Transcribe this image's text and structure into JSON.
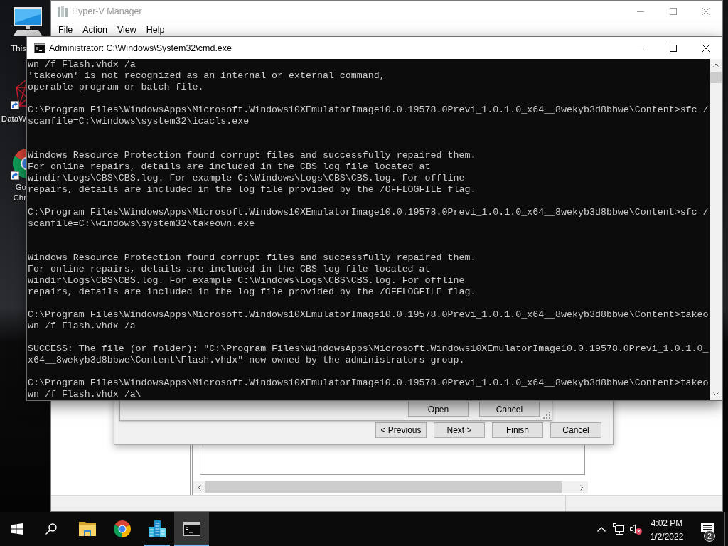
{
  "desktop": {
    "icons": [
      {
        "kind": "computer",
        "label_lines": [
          "This"
        ],
        "shortcut": false
      },
      {
        "kind": "mesh",
        "label_lines": [
          "DataW"
        ],
        "shortcut": true
      },
      {
        "kind": "browser",
        "label_lines": [
          "Go",
          "Chr"
        ],
        "shortcut": true
      }
    ]
  },
  "hyperv_window": {
    "title": "Hyper-V Manager",
    "active": false,
    "menu": [
      "File",
      "Action",
      "View",
      "Help"
    ]
  },
  "wizard_dialog": {
    "buttons": [
      "< Previous",
      "Next >",
      "Finish",
      "Cancel"
    ]
  },
  "open_dialog": {
    "buttons": [
      "Open",
      "Cancel"
    ]
  },
  "console_window": {
    "title": "Administrator: C:\\Windows\\System32\\cmd.exe",
    "active": true,
    "blocks": [
      {
        "kind": "text",
        "lines": [
          "wn /f Flash.vhdx /a",
          "'takeown' is not recognized as an internal or external command,",
          "operable program or batch file."
        ]
      },
      {
        "kind": "text",
        "lines": [
          "C:\\Program Files\\WindowsApps\\Microsoft.Windows10XEmulatorImage10.0.19578.0Previ_1.0.1.0_x64__8wekyb3d8bbwe\\Content>sfc /",
          "scanfile=C:\\windows\\system32\\icacls.exe"
        ]
      },
      {
        "kind": "report",
        "lines": [
          "Windows Resource Protection found corrupt files and successfully repaired them.",
          "For online repairs, details are included in the CBS log file located at",
          "windir\\Logs\\CBS\\CBS.log. For example C:\\Windows\\Logs\\CBS\\CBS.log. For offline",
          "repairs, details are included in the log file provided by the /OFFLOGFILE flag."
        ]
      },
      {
        "kind": "text",
        "lines": [
          "C:\\Program Files\\WindowsApps\\Microsoft.Windows10XEmulatorImage10.0.19578.0Previ_1.0.1.0_x64__8wekyb3d8bbwe\\Content>sfc /",
          "scanfile=C:\\windows\\system32\\takeown.exe"
        ]
      },
      {
        "kind": "report",
        "lines": [
          "Windows Resource Protection found corrupt files and successfully repaired them.",
          "For online repairs, details are included in the CBS log file located at",
          "windir\\Logs\\CBS\\CBS.log. For example C:\\Windows\\Logs\\CBS\\CBS.log. For offline",
          "repairs, details are included in the log file provided by the /OFFLOGFILE flag."
        ]
      },
      {
        "kind": "text",
        "lines": [
          "C:\\Program Files\\WindowsApps\\Microsoft.Windows10XEmulatorImage10.0.19578.0Previ_1.0.1.0_x64__8wekyb3d8bbwe\\Content>takeo",
          "wn /f Flash.vhdx /a"
        ]
      },
      {
        "kind": "text",
        "lines": [
          "SUCCESS: The file (or folder): \"C:\\Program Files\\WindowsApps\\Microsoft.Windows10XEmulatorImage10.0.19578.0Previ_1.0.1.0_",
          "x64__8wekyb3d8bbwe\\Content\\Flash.vhdx\" now owned by the administrators group."
        ]
      },
      {
        "kind": "text",
        "lines": [
          "C:\\Program Files\\WindowsApps\\Microsoft.Windows10XEmulatorImage10.0.19578.0Previ_1.0.1.0_x64__8wekyb3d8bbwe\\Content>takeo",
          "wn /f Flash.vhdx /a\\"
        ]
      }
    ]
  },
  "taskbar": {
    "apps": [
      {
        "kind": "explorer",
        "running": false,
        "selected": false
      },
      {
        "kind": "browser",
        "running": false,
        "selected": false
      },
      {
        "kind": "server",
        "running": true,
        "selected": false
      },
      {
        "kind": "terminal",
        "running": true,
        "selected": true
      }
    ],
    "tray": {
      "volume_muted": true,
      "time": "4:02 PM",
      "date": "1/2/2022",
      "notification_count": "2"
    }
  }
}
